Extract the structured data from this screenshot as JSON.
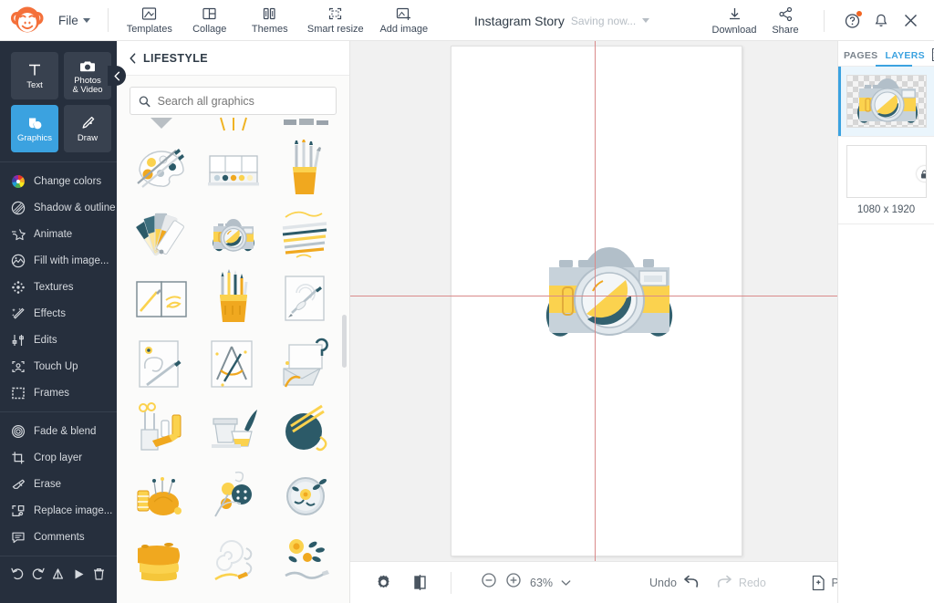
{
  "app": {
    "name": "PicMonkey",
    "logo_icon": "monkey-logo-icon",
    "accent_blue": "#3ba2e0",
    "brand_orange": "#f26522",
    "sidebar_bg": "#262f3d"
  },
  "topbar": {
    "file_menu": {
      "label": "File",
      "icon": "chevron-down-icon"
    },
    "tools": [
      {
        "label": "Templates",
        "icon": "templates-icon"
      },
      {
        "label": "Collage",
        "icon": "collage-icon"
      },
      {
        "label": "Themes",
        "icon": "themes-icon"
      },
      {
        "label": "Smart resize",
        "icon": "smart-resize-icon"
      },
      {
        "label": "Add image",
        "icon": "add-image-icon"
      }
    ],
    "document_title": "Instagram Story",
    "save_status": "Saving now...",
    "save_status_icon": "chevron-down-icon",
    "actions": [
      {
        "label": "Download",
        "icon": "download-icon"
      },
      {
        "label": "Share",
        "icon": "share-icon"
      }
    ],
    "help_icon": "help-question-icon",
    "help_badge": true,
    "notifications_icon": "bell-icon",
    "close_icon": "close-x-icon"
  },
  "sidebar": {
    "modes": [
      {
        "label": "Text",
        "icon": "text-t-icon",
        "active": false
      },
      {
        "label": "Photos\n& Video",
        "label_line1": "Photos",
        "label_line2": "& Video",
        "icon": "camera-icon",
        "active": false
      },
      {
        "label": "Graphics",
        "icon": "graphics-shapes-icon",
        "active": true
      },
      {
        "label": "Draw",
        "icon": "draw-pen-icon",
        "active": false
      }
    ],
    "group1": [
      {
        "label": "Change colors",
        "icon": "color-wheel-icon"
      },
      {
        "label": "Shadow & outline",
        "icon": "shadow-outline-icon"
      },
      {
        "label": "Animate",
        "icon": "animate-star-icon"
      },
      {
        "label": "Fill with image...",
        "icon": "fill-image-icon"
      },
      {
        "label": "Textures",
        "icon": "textures-icon"
      },
      {
        "label": "Effects",
        "icon": "effects-wand-icon"
      },
      {
        "label": "Edits",
        "icon": "edits-sliders-icon"
      },
      {
        "label": "Touch Up",
        "icon": "touch-up-face-icon"
      },
      {
        "label": "Frames",
        "icon": "frames-icon"
      }
    ],
    "group2": [
      {
        "label": "Fade & blend",
        "icon": "fade-blend-icon"
      },
      {
        "label": "Crop layer",
        "icon": "crop-icon"
      },
      {
        "label": "Erase",
        "icon": "eraser-icon"
      },
      {
        "label": "Replace image...",
        "icon": "replace-image-icon"
      },
      {
        "label": "Comments",
        "icon": "comment-bubble-icon"
      }
    ],
    "history_buttons": [
      {
        "name": "undo-icon"
      },
      {
        "name": "redo-icon"
      },
      {
        "name": "flip-vertical-icon"
      },
      {
        "name": "flip-horizontal-icon"
      },
      {
        "name": "delete-trash-icon"
      }
    ],
    "collapse_icon": "chevron-left-icon"
  },
  "graphics_panel": {
    "back_icon": "chevron-left-icon",
    "category_title": "LIFESTYLE",
    "search": {
      "placeholder": "Search all graphics",
      "value": "",
      "icon": "search-icon"
    },
    "items": [
      {
        "name": "paint-palette-brushes"
      },
      {
        "name": "watercolor-paint-set"
      },
      {
        "name": "brush-cup"
      },
      {
        "name": "color-swatch-fan"
      },
      {
        "name": "vintage-camera"
      },
      {
        "name": "pencils-scattered"
      },
      {
        "name": "open-sketchbook"
      },
      {
        "name": "colored-pencil-cup"
      },
      {
        "name": "sketch-paper-pen"
      },
      {
        "name": "notepad-pen-flower"
      },
      {
        "name": "drafting-tools-paper"
      },
      {
        "name": "envelope-letter-set"
      },
      {
        "name": "craft-supplies-scissors"
      },
      {
        "name": "pottery-bowls-plant"
      },
      {
        "name": "yarn-ball-knitting"
      },
      {
        "name": "pincushion-thread"
      },
      {
        "name": "sewing-buttons-needle"
      },
      {
        "name": "embroidery-hoop-floral"
      },
      {
        "name": "paint-strokes-swatch"
      },
      {
        "name": "wire-spiral-pliers"
      },
      {
        "name": "floral-ribbon-bouquet"
      }
    ]
  },
  "canvas": {
    "guide_color": "#d98a8a",
    "layer_graphic": "vintage-camera-graphic",
    "background": "#f1f1f1"
  },
  "bottombar": {
    "settings_icon": "gear-icon",
    "compare_icon": "compare-split-icon",
    "zoom_out_icon": "zoom-minus-icon",
    "zoom_in_icon": "zoom-plus-icon",
    "zoom_level": "63%",
    "zoom_dropdown_icon": "chevron-down-icon",
    "undo_label": "Undo",
    "undo_icon": "undo-arrow-icon",
    "redo_label": "Redo",
    "redo_icon": "redo-arrow-icon",
    "redo_disabled": true,
    "pages_label": "Pages",
    "pages_icon": "add-page-icon",
    "layers_icon": "layers-stack-icon"
  },
  "right_panel": {
    "tabs": [
      {
        "label": "PAGES",
        "active": false
      },
      {
        "label": "LAYERS",
        "active": true
      }
    ],
    "close_icon": "close-x-boxed-icon",
    "layers": [
      {
        "name": "camera-graphic-layer",
        "thumb": "vintage-camera",
        "selected": true,
        "caption": "",
        "locked": false
      },
      {
        "name": "background-layer",
        "thumb": "blank-white",
        "selected": false,
        "caption": "1080 x 1920",
        "locked": true,
        "lock_icon": "lock-icon"
      }
    ]
  }
}
